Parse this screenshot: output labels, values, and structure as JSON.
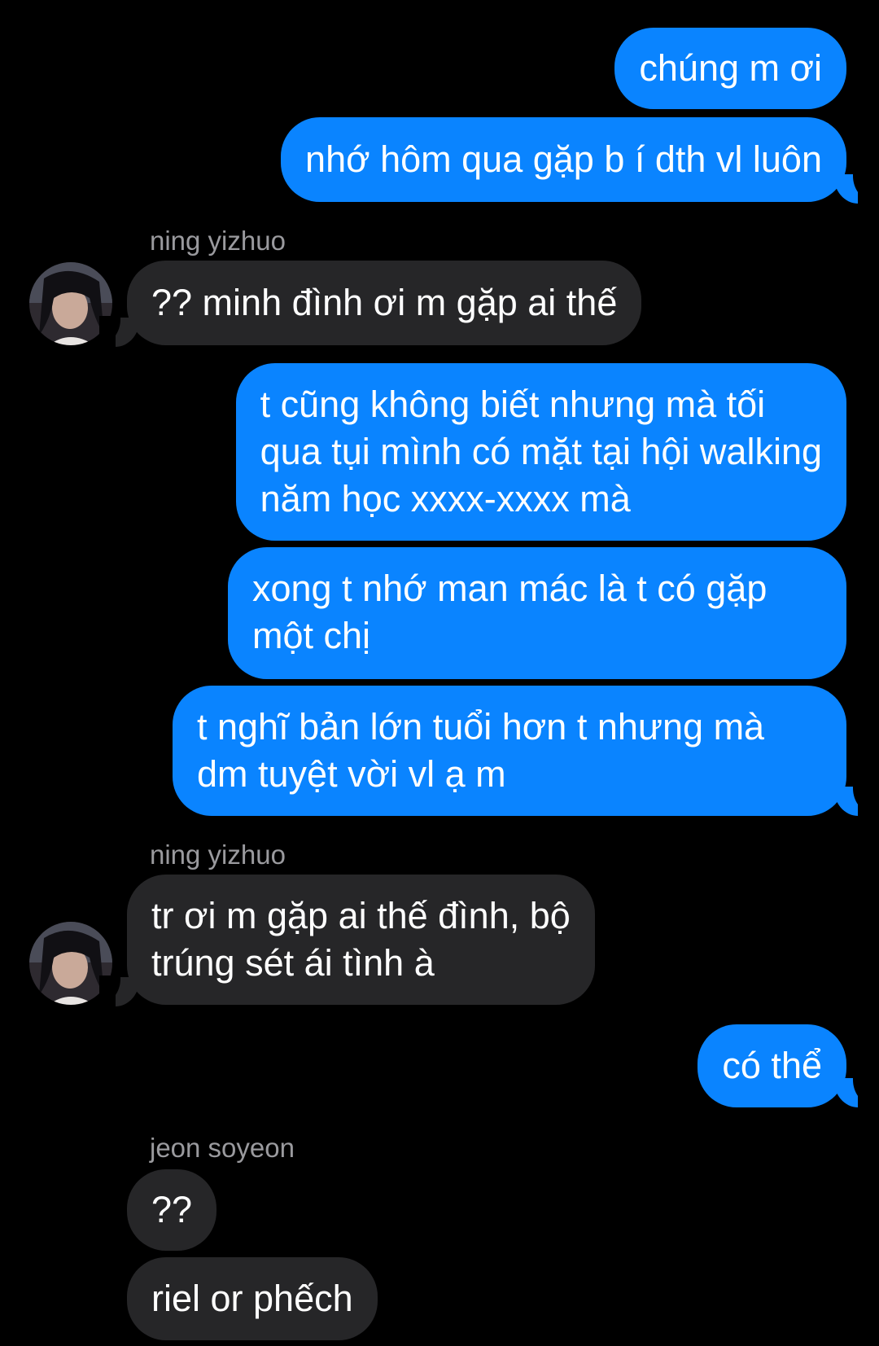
{
  "conversation": {
    "messages": [
      {
        "direction": "outgoing",
        "text": "chúng m ơi"
      },
      {
        "direction": "outgoing",
        "text": "nhớ hôm qua gặp b í dth vl luôn"
      },
      {
        "direction": "incoming",
        "sender": "ning yizhuo",
        "text": "?? minh đình ơi m gặp ai thế"
      },
      {
        "direction": "outgoing",
        "lines": [
          "t cũng không biết nhưng mà tối",
          "qua tụi mình có mặt tại hội walking",
          "năm học xxxx-xxxx mà"
        ]
      },
      {
        "direction": "outgoing",
        "lines": [
          "xong t nhớ man mác là t có gặp",
          "một chị"
        ]
      },
      {
        "direction": "outgoing",
        "lines": [
          "t nghĩ bản lớn tuổi hơn t nhưng mà",
          "dm tuyệt vời vl ạ m"
        ]
      },
      {
        "direction": "incoming",
        "sender": "ning yizhuo",
        "lines": [
          "tr ơi m gặp ai thế đình, bộ",
          "trúng sét ái tình à"
        ]
      },
      {
        "direction": "outgoing",
        "text": "có thể"
      },
      {
        "direction": "incoming",
        "sender": "jeon soyeon",
        "text": "??"
      },
      {
        "direction": "incoming",
        "text": "riel or phếch"
      }
    ]
  },
  "colors": {
    "background": "#000000",
    "outgoing_bubble": "#0a84ff",
    "incoming_bubble": "#262628",
    "sender_name": "#9a9a9e",
    "text": "#ffffff"
  }
}
